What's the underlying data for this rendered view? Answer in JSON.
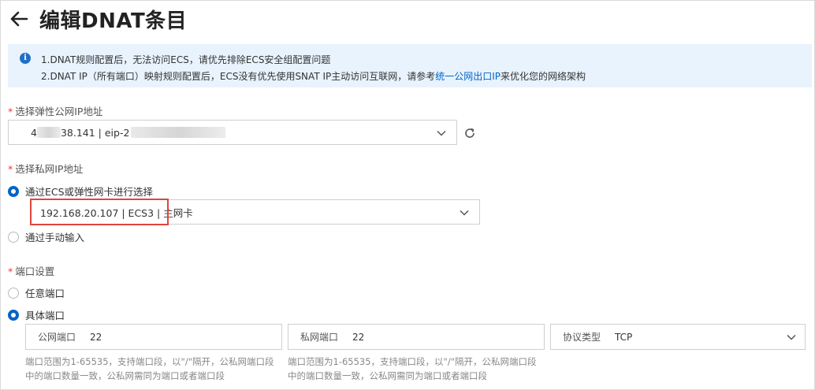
{
  "header": {
    "title": "编辑DNAT条目"
  },
  "notice": {
    "line1": "1.DNAT规则配置后，无法访问ECS，请优先排除ECS安全组配置问题",
    "line2_pre": "2.DNAT IP（所有端口）映射规则配置后，ECS没有优先使用SNAT IP主动访问互联网，请参考",
    "line2_link": "统一公网出口IP",
    "line2_post": "来优化您的网络架构"
  },
  "eip": {
    "label": "选择弹性公网IP地址",
    "value_prefix": "4",
    "value_mid": "38.141 | eip-2"
  },
  "private_ip": {
    "label": "选择私网IP地址",
    "option_ecs": "通过ECS或弹性网卡进行选择",
    "selected_value": "192.168.20.107 | ECS3 | 主网卡",
    "option_manual": "通过手动输入"
  },
  "port": {
    "label": "端口设置",
    "option_any": "任意端口",
    "option_specific": "具体端口",
    "public_label": "公网端口",
    "public_value": "22",
    "private_label": "私网端口",
    "private_value": "22",
    "protocol_label": "协议类型",
    "protocol_value": "TCP",
    "hint_line1": "端口范围为1-65535，支持端口段，以\"/\"隔开，公私网端口段",
    "hint_line2": "中的端口数量一致，公私网需同为端口或者端口段"
  }
}
